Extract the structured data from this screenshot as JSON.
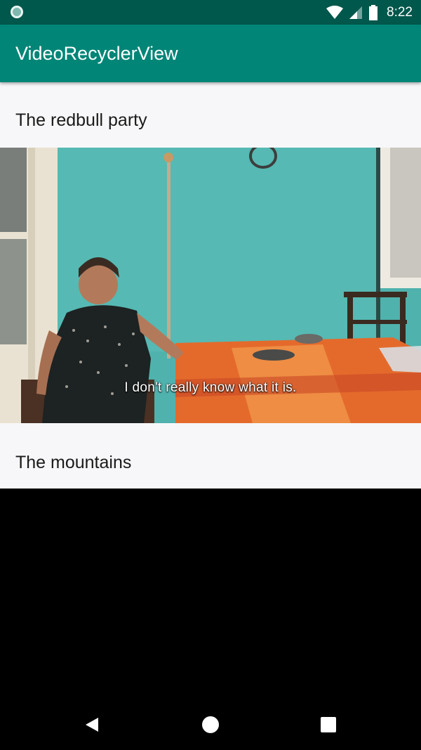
{
  "status_bar": {
    "time": "8:22",
    "icons": [
      "notification-ring-icon",
      "wifi-icon",
      "signal-icon",
      "battery-icon"
    ]
  },
  "app_bar": {
    "title": "VideoRecyclerView",
    "color": "#008577",
    "status_color": "#00574b"
  },
  "list": {
    "items": [
      {
        "title": "The redbull party",
        "subtitle": "I don't really know what it is."
      },
      {
        "title": "The mountains"
      }
    ]
  },
  "nav_bar": {
    "buttons": [
      "back-icon",
      "home-icon",
      "recents-icon"
    ]
  }
}
